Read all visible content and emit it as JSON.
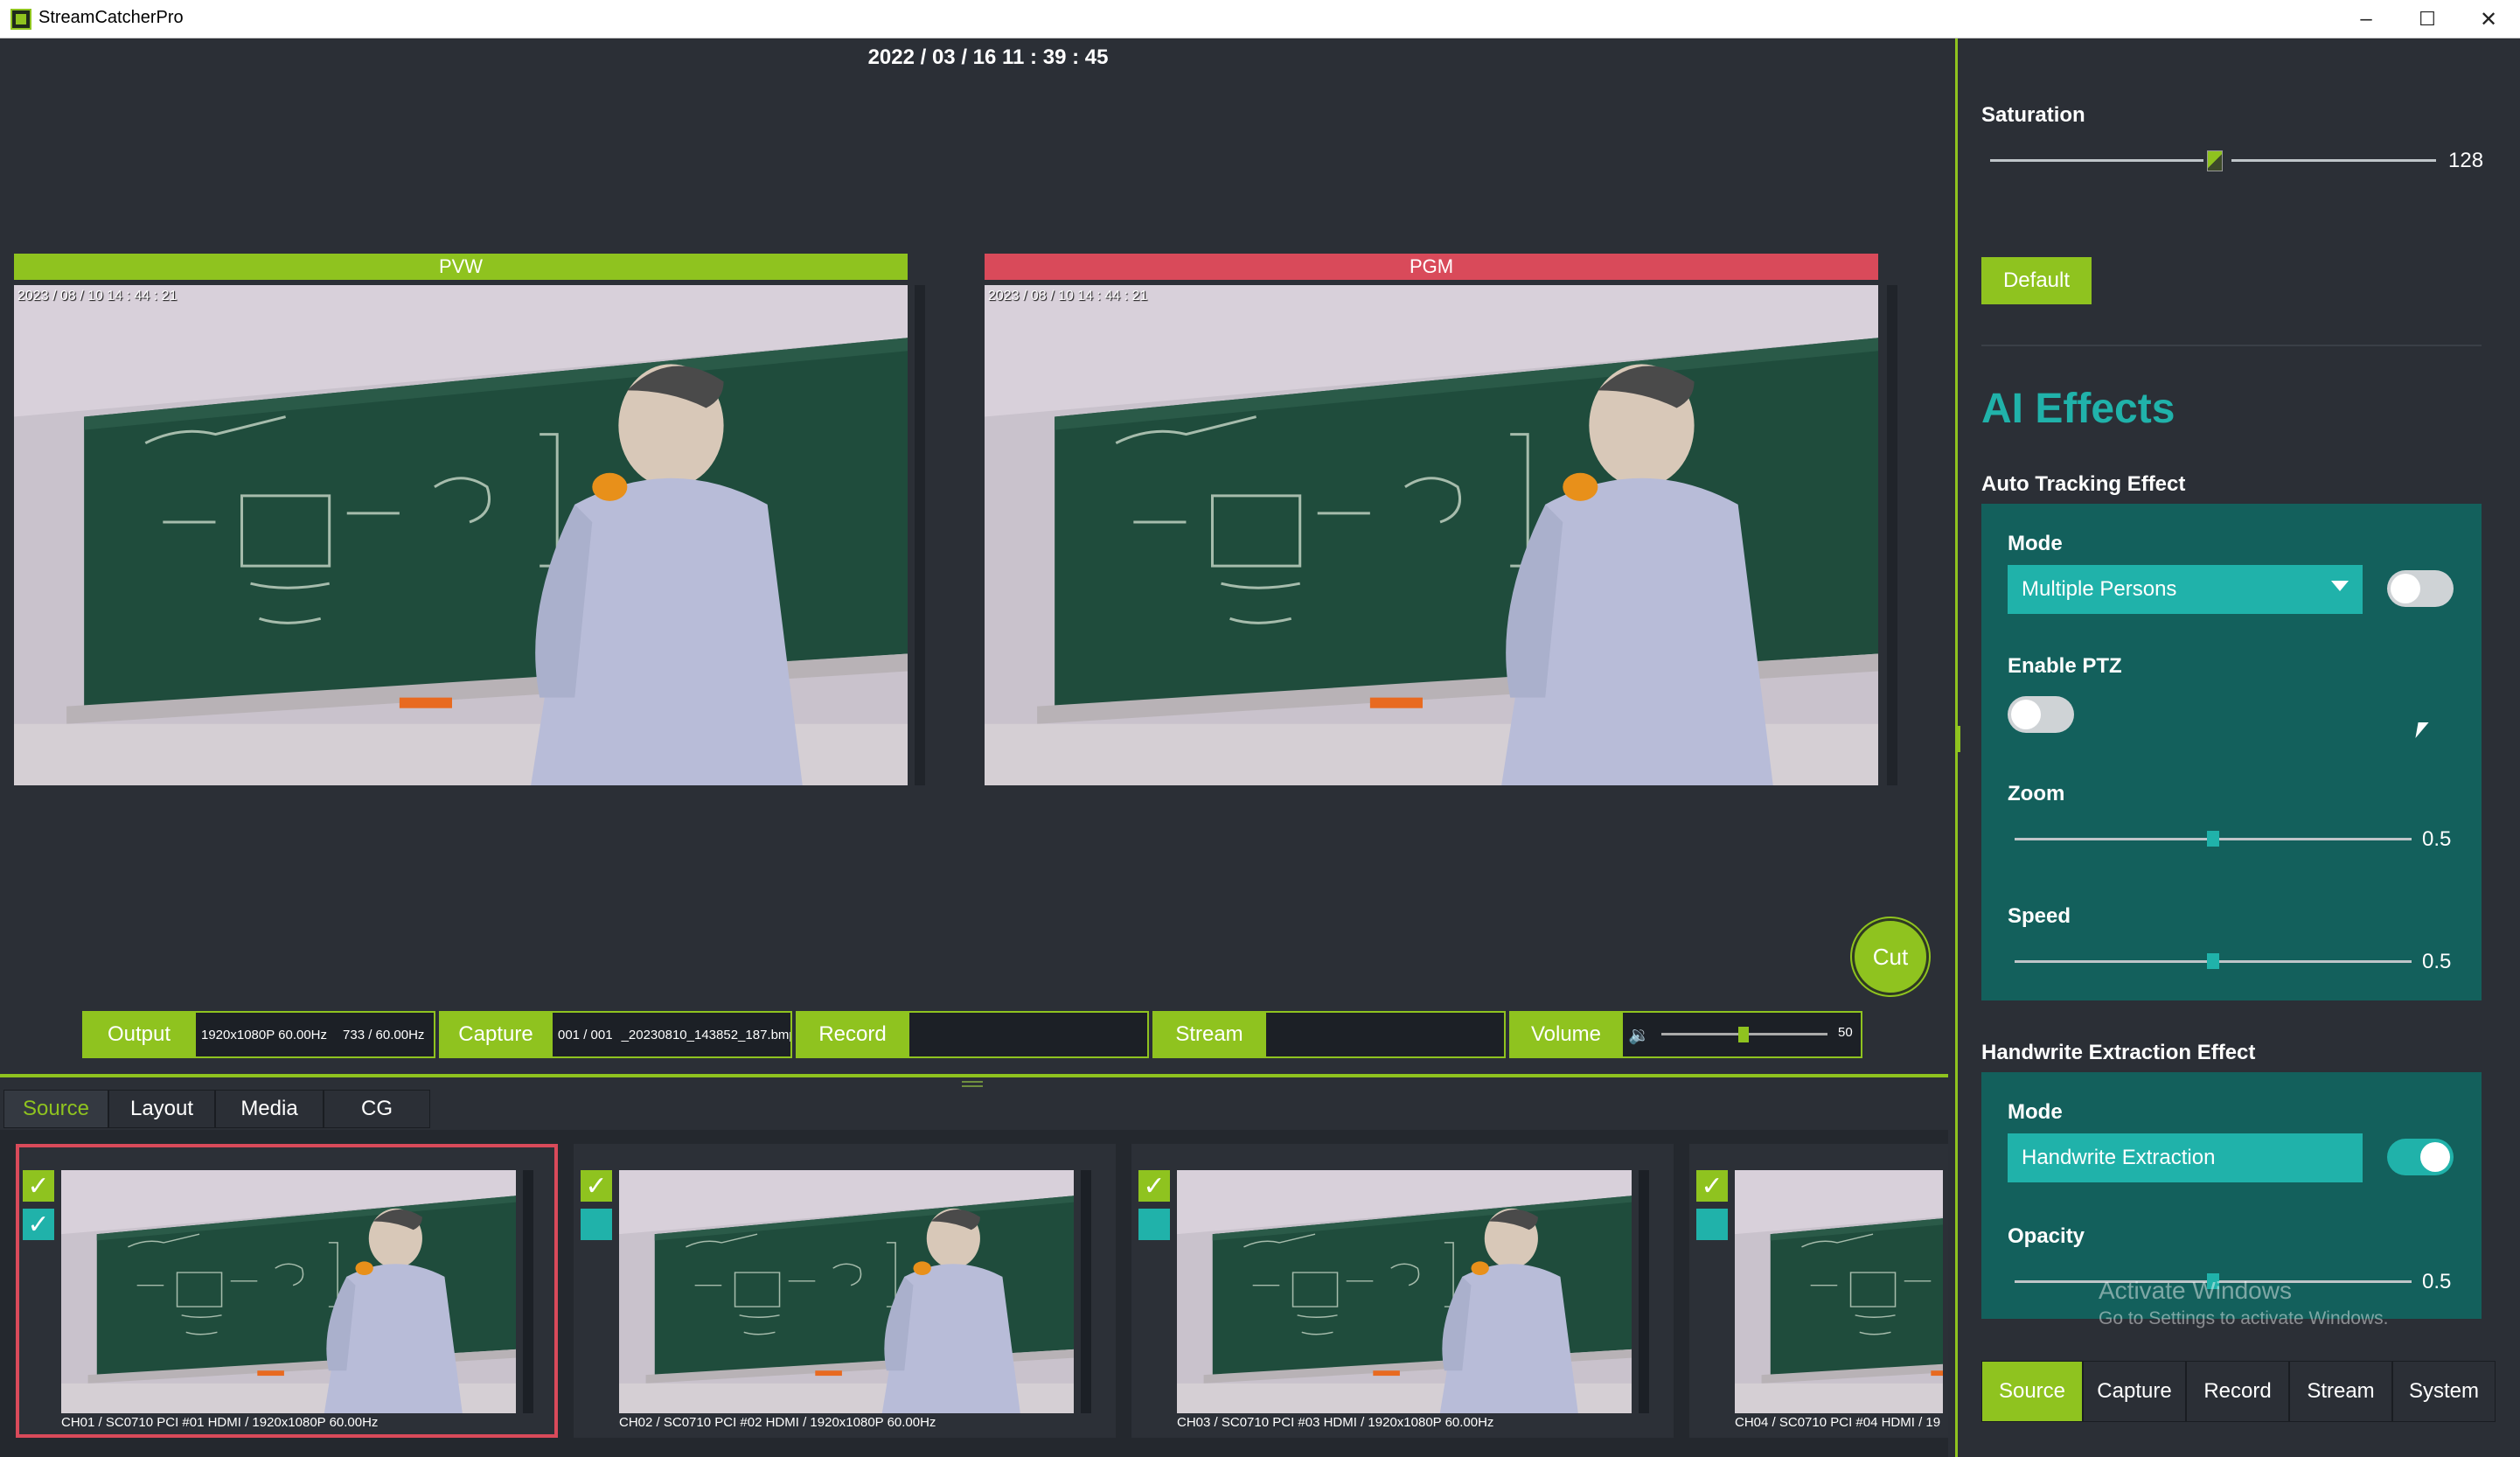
{
  "window": {
    "title": "StreamCatcherPro"
  },
  "main": {
    "datetime": "2022 / 03 / 16    11 : 39 : 45"
  },
  "preview": {
    "label": "PVW",
    "timestamp": "2023 / 08 / 10   14 : 44 : 21"
  },
  "program": {
    "label": "PGM",
    "timestamp": "2023 / 08 / 10   14 : 44 : 21"
  },
  "cut_label": "Cut",
  "statusbar": {
    "output_label": "Output",
    "output_resolution": "1920x1080P 60.00Hz",
    "output_frames": "733 / 60.00Hz",
    "capture_label": "Capture",
    "capture_count": "001 / 001",
    "capture_file": "_20230810_143852_187.bmp",
    "record_label": "Record",
    "stream_label": "Stream",
    "volume_label": "Volume",
    "volume_value": "50"
  },
  "bottom_tabs": [
    "Source",
    "Layout",
    "Media",
    "CG"
  ],
  "sources": [
    {
      "label": "CH01 / SC0710 PCI #01 HDMI / 1920x1080P 60.00Hz"
    },
    {
      "label": "CH02 / SC0710 PCI #02 HDMI / 1920x1080P 60.00Hz"
    },
    {
      "label": "CH03 / SC0710 PCI #03 HDMI / 1920x1080P 60.00Hz"
    },
    {
      "label": "CH04 / SC0710 PCI #04 HDMI / 19"
    }
  ],
  "right_panel": {
    "saturation_label": "Saturation",
    "saturation_value": "128",
    "default_label": "Default",
    "ai_title": "AI Effects",
    "auto_tracking": {
      "title": "Auto Tracking Effect",
      "mode_label": "Mode",
      "mode_value": "Multiple Persons",
      "enable_ptz_label": "Enable PTZ",
      "zoom_label": "Zoom",
      "zoom_value": "0.5",
      "speed_label": "Speed",
      "speed_value": "0.5"
    },
    "handwrite": {
      "title": "Handwrite Extraction Effect",
      "mode_label": "Mode",
      "mode_value": "Handwrite Extraction",
      "opacity_label": "Opacity",
      "opacity_value": "0.5"
    },
    "tabs": [
      "Source",
      "Capture",
      "Record",
      "Stream",
      "System"
    ]
  },
  "watermark": {
    "title": "Activate Windows",
    "subtitle": "Go to Settings to activate Windows."
  },
  "colors": {
    "accent_green": "#8fc31f",
    "accent_teal": "#20b2aa",
    "pgm_red": "#d94a5a",
    "panel_bg": "#2b2f36"
  }
}
